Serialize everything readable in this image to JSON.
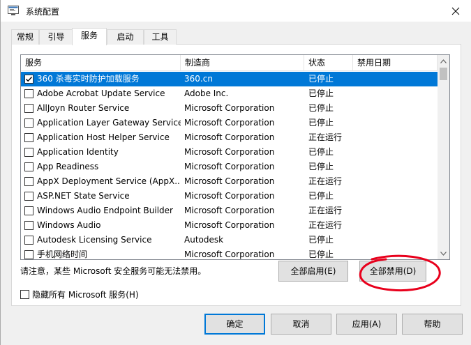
{
  "window": {
    "title": "系统配置",
    "icon": "msconfig-icon"
  },
  "tabs": [
    {
      "label": "常规"
    },
    {
      "label": "引导"
    },
    {
      "label": "服务"
    },
    {
      "label": "启动"
    },
    {
      "label": "工具"
    }
  ],
  "active_tab": "服务",
  "services": {
    "columns": {
      "service": "服务",
      "manufacturer": "制造商",
      "status": "状态",
      "disabled_date": "禁用日期"
    },
    "rows": [
      {
        "name": "360 杀毒实时防护加载服务",
        "manufacturer": "360.cn",
        "status": "已停止",
        "disabled_date": "",
        "checked": true,
        "selected": true
      },
      {
        "name": "Adobe Acrobat Update Service",
        "manufacturer": "Adobe Inc.",
        "status": "已停止",
        "disabled_date": "",
        "checked": false
      },
      {
        "name": "AllJoyn Router Service",
        "manufacturer": "Microsoft Corporation",
        "status": "已停止",
        "disabled_date": "",
        "checked": false
      },
      {
        "name": "Application Layer Gateway Service",
        "manufacturer": "Microsoft Corporation",
        "status": "已停止",
        "disabled_date": "",
        "checked": false
      },
      {
        "name": "Application Host Helper Service",
        "manufacturer": "Microsoft Corporation",
        "status": "正在运行",
        "disabled_date": "",
        "checked": false
      },
      {
        "name": "Application Identity",
        "manufacturer": "Microsoft Corporation",
        "status": "已停止",
        "disabled_date": "",
        "checked": false
      },
      {
        "name": "App Readiness",
        "manufacturer": "Microsoft Corporation",
        "status": "已停止",
        "disabled_date": "",
        "checked": false
      },
      {
        "name": "AppX Deployment Service (AppX...",
        "manufacturer": "Microsoft Corporation",
        "status": "正在运行",
        "disabled_date": "",
        "checked": false
      },
      {
        "name": "ASP.NET State Service",
        "manufacturer": "Microsoft Corporation",
        "status": "已停止",
        "disabled_date": "",
        "checked": false
      },
      {
        "name": "Windows Audio Endpoint Builder",
        "manufacturer": "Microsoft Corporation",
        "status": "正在运行",
        "disabled_date": "",
        "checked": false
      },
      {
        "name": "Windows Audio",
        "manufacturer": "Microsoft Corporation",
        "status": "正在运行",
        "disabled_date": "",
        "checked": false
      },
      {
        "name": "Autodesk Licensing Service",
        "manufacturer": "Autodesk",
        "status": "已停止",
        "disabled_date": "",
        "checked": false
      },
      {
        "name": "手机网络时间",
        "manufacturer": "Microsoft Corporation",
        "status": "已停止",
        "disabled_date": "",
        "checked": false
      }
    ]
  },
  "notice": "请注意，某些 Microsoft 安全服务可能无法禁用。",
  "buttons": {
    "enable_all": "全部启用(E)",
    "disable_all": "全部禁用(D)",
    "ok": "确定",
    "cancel": "取消",
    "apply": "应用(A)",
    "help": "帮助"
  },
  "hide_ms": {
    "label": "隐藏所有 Microsoft 服务(H)",
    "checked": false
  },
  "colors": {
    "selection": "#0078d7",
    "annotation": "#e8001c",
    "window_bg": "#f0f0f0",
    "default_button_border": "#0078d7"
  }
}
